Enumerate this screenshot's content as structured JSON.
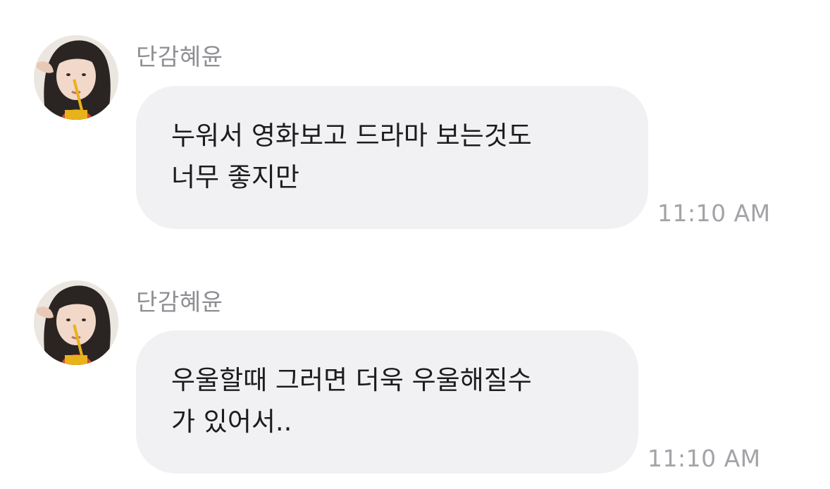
{
  "messages": [
    {
      "sender": "단감혜윤",
      "lines": [
        "누워서 영화보고 드라마 보는것도",
        "너무 좋지만"
      ],
      "time": "11:10 AM"
    },
    {
      "sender": "단감혜윤",
      "lines": [
        "우울할때 그러면 더욱 우울해질수",
        "가 있어서.."
      ],
      "time": "11:10 AM"
    }
  ],
  "colors": {
    "bubble": "#f1f1f4",
    "sender": "#8e8e93",
    "time": "#a3a3a8",
    "text": "#1c1c1e"
  }
}
